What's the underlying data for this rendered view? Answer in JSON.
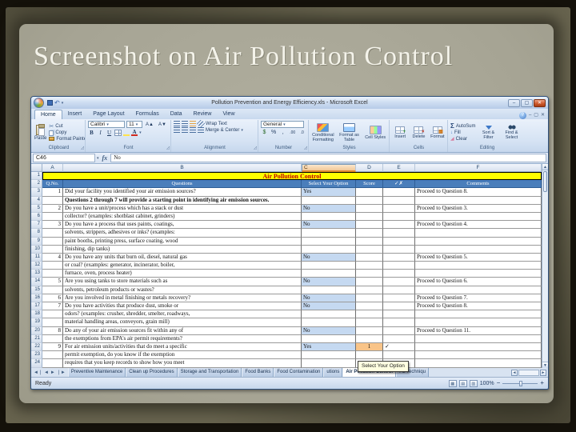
{
  "slide": {
    "title": "Screenshot on Air Pollution Control"
  },
  "colors": {
    "yellow": "#ffff00",
    "red": "#c00000",
    "headerblue": "#4a7ebb",
    "optblue": "#c5d9f1",
    "scoreorange": "#f9c488"
  },
  "icons": {
    "dropdown": "▾",
    "undo": "↶",
    "scissors": "✂",
    "minimize": "–",
    "maximize": "▢",
    "close": "✕",
    "help": "?",
    "sigma": "Σ",
    "bold": "B",
    "italic": "I",
    "underline": "U",
    "grow_font": "A▲",
    "shrink_font": "A▼",
    "fill_color": "A",
    "font_color": "A",
    "dollar": "$",
    "percent": "%",
    "comma": ",",
    "inc_decimal": ".00",
    "dec_decimal": ".0",
    "fill_arrow": "↓",
    "clear": "◢",
    "up_arrow": "▲",
    "down_arrow": "▼",
    "tab_first": "◄❘",
    "tab_prev": "◄",
    "tab_next": "►",
    "tab_last": "❘►",
    "h_left": "◄",
    "h_right": "►"
  },
  "excel": {
    "window_title": "Pollution Prevention and Energy Efficiency.xls - Microsoft Excel",
    "ribbon_tabs": [
      "Home",
      "Insert",
      "Page Layout",
      "Formulas",
      "Data",
      "Review",
      "View"
    ],
    "groups": {
      "clipboard": {
        "label": "Clipboard",
        "paste": "Paste",
        "cut": "Cut",
        "copy": "Copy",
        "format_painter": "Format Painter"
      },
      "font": {
        "label": "Font",
        "family": "Calibri",
        "size": "11"
      },
      "alignment": {
        "label": "Alignment",
        "wrap": "Wrap Text",
        "merge": "Merge & Center"
      },
      "number": {
        "label": "Number",
        "format": "General"
      },
      "styles": {
        "label": "Styles",
        "conditional": "Conditional Formatting",
        "format_table": "Format as Table",
        "cell_styles": "Cell Styles"
      },
      "cells": {
        "label": "Cells",
        "insert": "Insert",
        "delete": "Delete",
        "format": "Format"
      },
      "editing": {
        "label": "Editing",
        "autosum": "AutoSum",
        "fill": "Fill",
        "clear": "Clear",
        "sort": "Sort & Filter",
        "find": "Find & Select"
      }
    },
    "formula_bar": {
      "name_box": "C46",
      "fx": "fx",
      "value": "No"
    },
    "sheet": {
      "banner": "Air Pollution Control",
      "banner_n": "1",
      "header_n": "2",
      "columns": [
        "A",
        "B",
        "C",
        "D",
        "E",
        "F"
      ],
      "highlighted_column": "C",
      "header": {
        "qno": "Q.No.",
        "questions": "Questions",
        "option": "Select Your Option",
        "score": "Score",
        "check": "✓✗",
        "comments": "Comments"
      },
      "rows": [
        {
          "n": "3",
          "qno": "1",
          "question": "Did your facility you identified your air emission sources?",
          "option": "Yes",
          "proceed": "Proceed to Question 8."
        },
        {
          "n": "4",
          "question": "Questions 2 through 7 will provide a starting point in identifying air emission sources.",
          "bold": true
        },
        {
          "n": "5",
          "qno": "2",
          "question": "Do you have a unit/process which has a stack or dust",
          "option": "No",
          "proceed": "Proceed to Question 3."
        },
        {
          "n": "6",
          "question": "collector? (examples: shotblast cabinet, grinders)"
        },
        {
          "n": "7",
          "qno": "3",
          "question": "Do you have a process that uses paints, coatings,",
          "option": "No",
          "proceed": "Proceed to Question 4."
        },
        {
          "n": "8",
          "question": "solvents, strippers, adhesives or inks? (examples:"
        },
        {
          "n": "9",
          "question": "paint booths, printing press, surface coating, wood"
        },
        {
          "n": "10",
          "question": "finishing, dip tanks)"
        },
        {
          "n": "11",
          "qno": "4",
          "question": "Do you have any units that burn oil, diesel, natural gas",
          "option": "No",
          "proceed": "Proceed to Question 5."
        },
        {
          "n": "12",
          "question": "or coal? (examples: generator, incinerator, boiler,"
        },
        {
          "n": "13",
          "question": "furnace, oven, process heater)"
        },
        {
          "n": "14",
          "qno": "5",
          "question": "Are you using tanks to store materials such as",
          "option": "No",
          "proceed": "Proceed to Question 6."
        },
        {
          "n": "15",
          "question": "solvents, petroleum products or wastes?"
        },
        {
          "n": "16",
          "qno": "6",
          "question": "Are you involved in metal finishing or metals recovery?",
          "option": "No",
          "proceed": "Proceed to Question 7."
        },
        {
          "n": "17",
          "qno": "7",
          "question": "Do you have activities that produce dust, smoke or",
          "option": "No",
          "proceed": "Proceed to Question 8."
        },
        {
          "n": "18",
          "question": "odors? (examples: crusher, shredder, smelter, roadways,"
        },
        {
          "n": "19",
          "question": "material handling areas, conveyors, grain mill)"
        },
        {
          "n": "20",
          "qno": "8",
          "question": "Do any of your air emission sources fit within any of",
          "option": "No",
          "proceed": "Proceed to Question 11."
        },
        {
          "n": "21",
          "question": "the exemptions from EPA's air permit requirements?"
        },
        {
          "n": "22",
          "qno": "9",
          "question": "For air emission units/activities that do meet a specific",
          "option": "Yes",
          "score": "1",
          "check": "✓"
        },
        {
          "n": "23",
          "question": "permit exemption, do you know if the exemption"
        },
        {
          "n": "24",
          "question": "requires that you keep records to show how you meet"
        }
      ]
    },
    "tabbar": {
      "tabs": [
        {
          "label": "Preventive Maintenance"
        },
        {
          "label": "Clean up Procedures"
        },
        {
          "label": "Storage and Transportation"
        },
        {
          "label": "Food Banks"
        },
        {
          "label": "Food Contamination"
        },
        {
          "label": "utions",
          "partial": true
        },
        {
          "label": "Air Pollution Control",
          "active": true
        },
        {
          "label": "P2 Techniqu",
          "partial": true
        }
      ]
    },
    "tooltip": "Select Your Option",
    "status": {
      "ready": "Ready",
      "zoom": "100%"
    }
  }
}
